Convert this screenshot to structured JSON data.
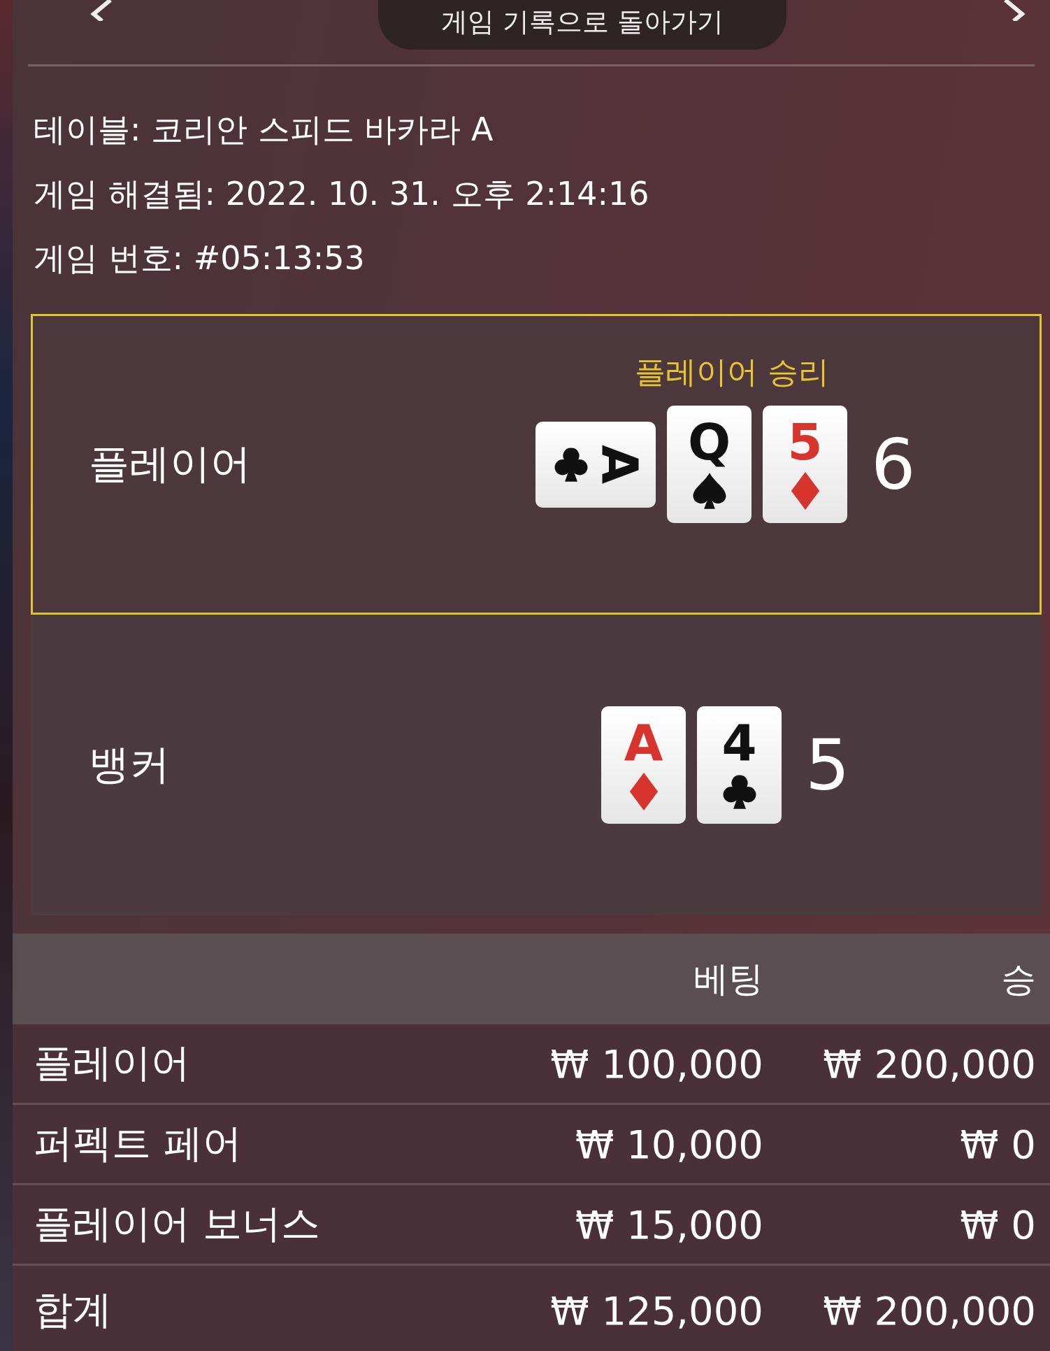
{
  "header": {
    "title": "게임 기록으로 돌아가기"
  },
  "info": [
    {
      "label": "테이블:",
      "value": "코리안 스피드 바카라 A"
    },
    {
      "label": "게임 해결됨:",
      "value": "2022. 10. 31. 오후 2:14:16"
    },
    {
      "label": "게임 번호:",
      "value": "#05:13:53"
    }
  ],
  "hands": [
    {
      "name": "플레이어",
      "winner": true,
      "result_label": "플레이어 승리",
      "score": "6",
      "cards": [
        {
          "rank": "A",
          "kind": "clubs",
          "sideways": true
        },
        {
          "rank": "Q",
          "kind": "spades",
          "sideways": false
        },
        {
          "rank": "5",
          "kind": "diamonds",
          "sideways": false
        }
      ]
    },
    {
      "name": "뱅커",
      "winner": false,
      "score": "5",
      "cards": [
        {
          "rank": "A",
          "kind": "diamonds",
          "sideways": false
        },
        {
          "rank": "4",
          "kind": "clubs",
          "sideways": false
        }
      ]
    }
  ],
  "bets": {
    "columns": [
      "베팅",
      "승"
    ],
    "rows": [
      {
        "label": "플레이어",
        "bet": "₩ 100,000",
        "win": "₩ 200,000"
      },
      {
        "label": "퍼펙트 페어",
        "bet": "₩ 10,000",
        "win": "₩ 0"
      },
      {
        "label": "플레이어 보너스",
        "bet": "₩ 15,000",
        "win": "₩ 0"
      }
    ],
    "total": {
      "label": "합계",
      "bet": "₩ 125,000",
      "win": "₩ 200,000"
    }
  }
}
